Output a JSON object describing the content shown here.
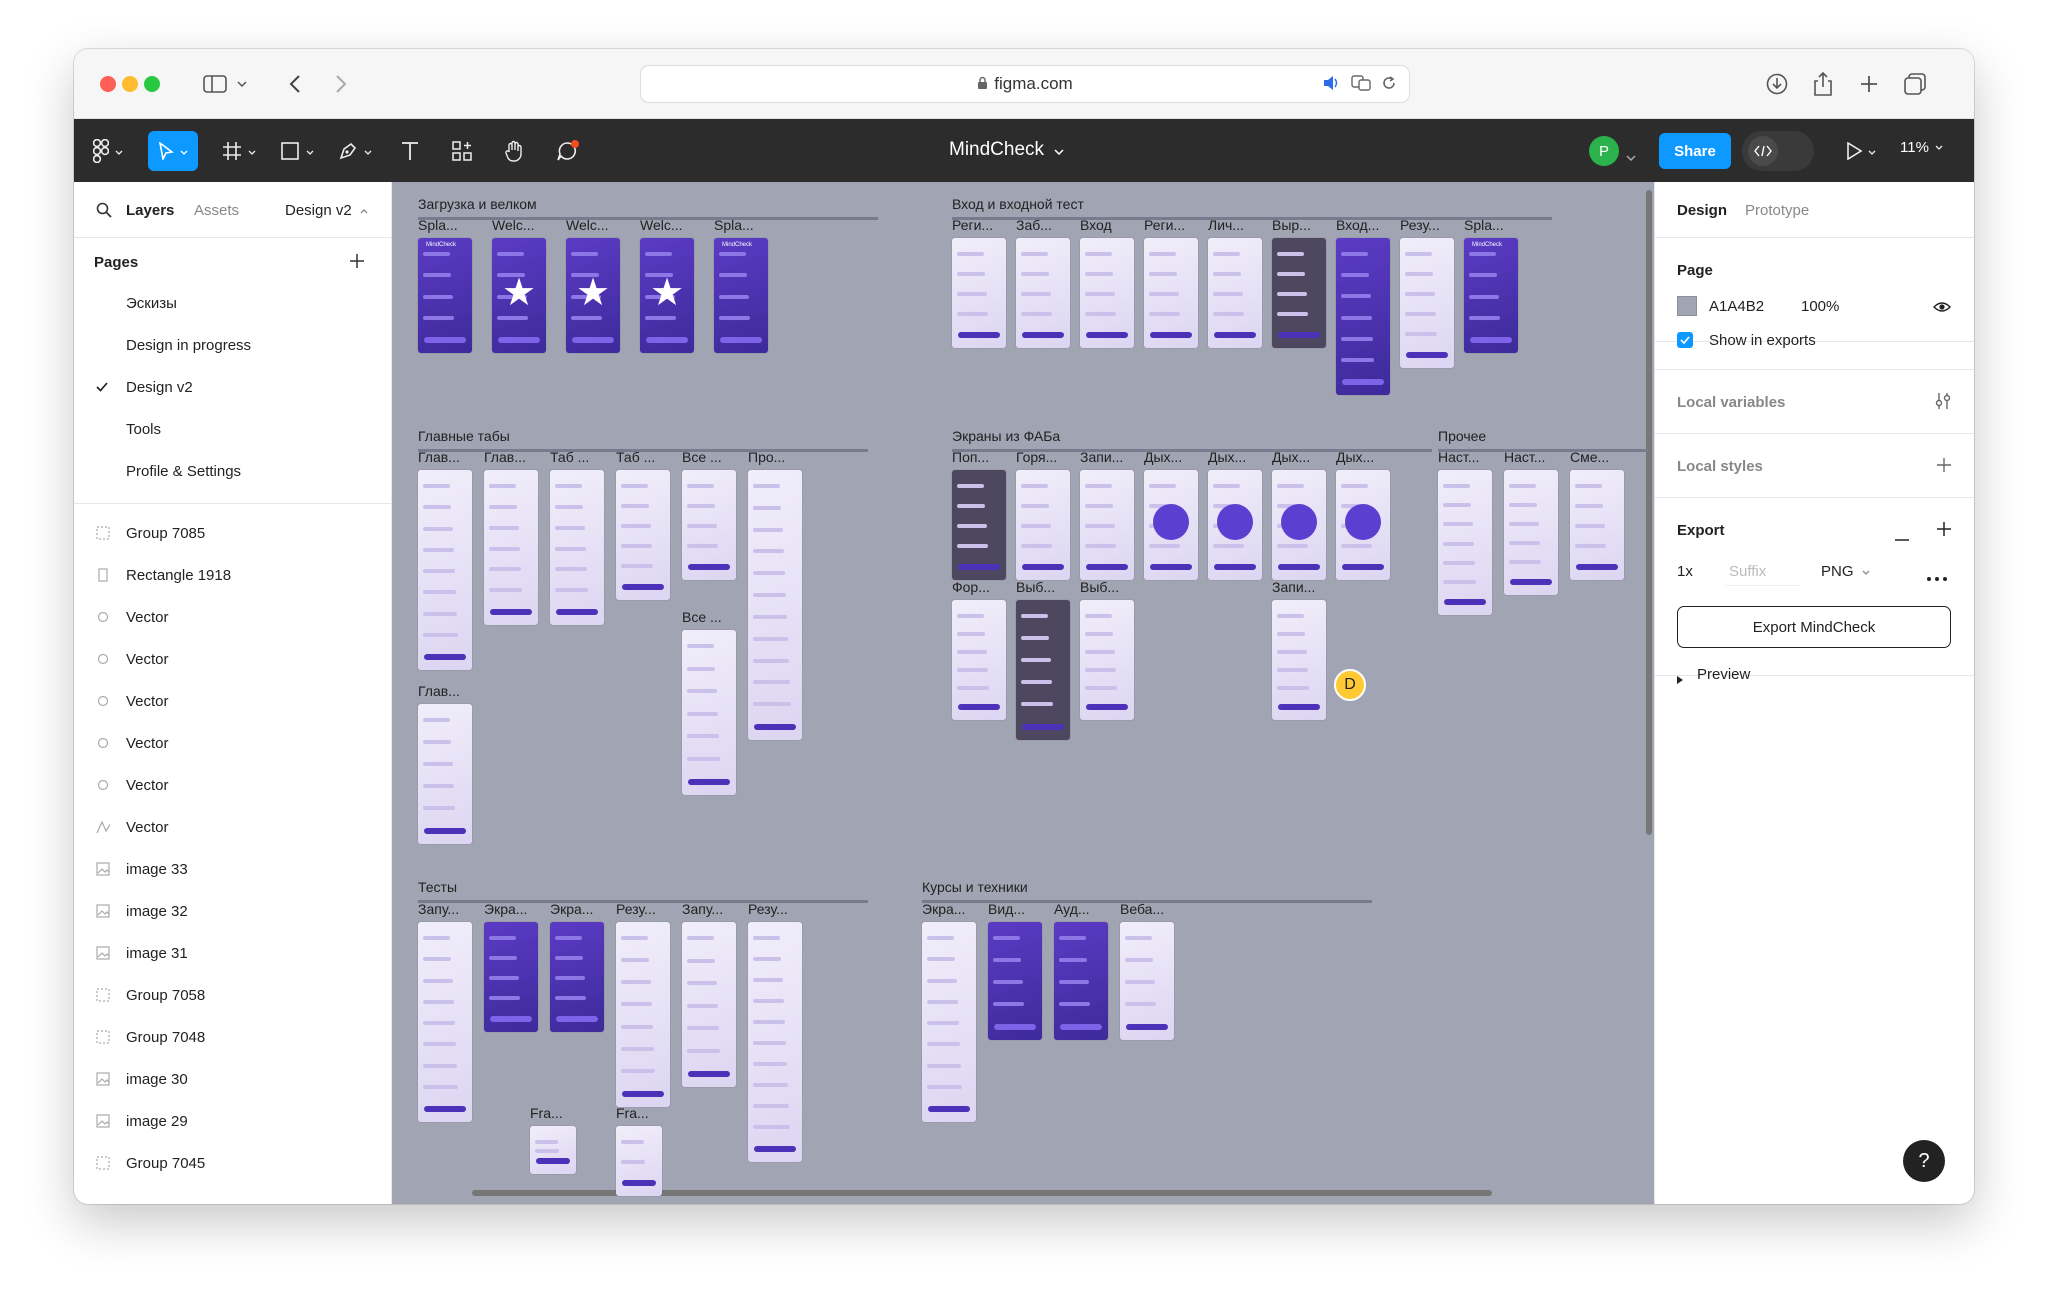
{
  "browser": {
    "url": "figma.com"
  },
  "toolbar": {
    "file_title": "MindCheck",
    "avatar_initial": "P",
    "share_label": "Share",
    "zoom": "11%"
  },
  "left_panel": {
    "tabs": [
      "Layers",
      "Assets"
    ],
    "page_dropdown": "Design v2",
    "pages_heading": "Pages",
    "pages": [
      "Эскизы",
      "Design in progress",
      "Design v2",
      "Tools",
      "Profile & Settings"
    ],
    "layers": [
      {
        "name": "Group 7085",
        "icon": "group-icon"
      },
      {
        "name": "Rectangle 1918",
        "icon": "rectangle-icon"
      },
      {
        "name": "Vector",
        "icon": "ellipse-icon"
      },
      {
        "name": "Vector",
        "icon": "ellipse-icon"
      },
      {
        "name": "Vector",
        "icon": "ellipse-icon"
      },
      {
        "name": "Vector",
        "icon": "ellipse-icon"
      },
      {
        "name": "Vector",
        "icon": "ellipse-icon"
      },
      {
        "name": "Vector",
        "icon": "vector-path-icon"
      },
      {
        "name": "image 33",
        "icon": "image-icon"
      },
      {
        "name": "image 32",
        "icon": "image-icon"
      },
      {
        "name": "image 31",
        "icon": "image-icon"
      },
      {
        "name": "Group 7058",
        "icon": "group-icon"
      },
      {
        "name": "Group 7048",
        "icon": "group-icon"
      },
      {
        "name": "image 30",
        "icon": "image-icon"
      },
      {
        "name": "image 29",
        "icon": "image-icon"
      },
      {
        "name": "Group 7045",
        "icon": "group-icon"
      }
    ]
  },
  "canvas": {
    "background": "#A1A4B2",
    "sections": {
      "s1": "Загрузка и велком",
      "s2": "Вход и входной тест",
      "s3": "Главные табы",
      "s4": "Экраны из ФАБа",
      "s5": "Прочее",
      "s6": "Тесты",
      "s7": "Курсы и техники"
    },
    "frame_labels": {
      "a1": "Spla...",
      "a2": "Welc...",
      "a3": "Welc...",
      "a4": "Welc...",
      "a5": "Spla...",
      "b1": "Реги...",
      "b2": "Заб...",
      "b3": "Вход",
      "b4": "Реги...",
      "b5": "Лич...",
      "b6": "Выр...",
      "b7": "Вход...",
      "b8": "Резу...",
      "b9": "Spla...",
      "c1": "Глав...",
      "c2": "Глав...",
      "c3": "Таб ...",
      "c4": "Таб ...",
      "c5": "Все ...",
      "c6": "Про...",
      "c7": "Все ...",
      "c8": "Глав...",
      "d1": "Поп...",
      "d2": "Горя...",
      "d3": "Запи...",
      "d4": "Дых...",
      "d5": "Дых...",
      "d6": "Дых...",
      "d7": "Дых...",
      "d8": "Фор...",
      "d9": "Выб...",
      "d10": "Выб...",
      "d11": "Запи...",
      "e1": "Наст...",
      "e2": "Наст...",
      "e3": "Сме...",
      "f1": "Запу...",
      "f2": "Экра...",
      "f3": "Экра...",
      "f4": "Резу...",
      "f5": "Запу...",
      "f6": "Резу...",
      "f7": "Fra...",
      "f8": "Fra...",
      "g1": "Экра...",
      "g2": "Вид...",
      "g3": "Ауд...",
      "g4": "Веба..."
    },
    "brand_mark": "MindCheck",
    "collaborator_initial": "D"
  },
  "right_panel": {
    "tabs": [
      "Design",
      "Prototype"
    ],
    "page_heading": "Page",
    "page_color_hex": "A1A4B2",
    "page_opacity": "100%",
    "show_in_exports": "Show in exports",
    "local_variables": "Local variables",
    "local_styles": "Local styles",
    "export_heading": "Export",
    "export_scale": "1x",
    "export_suffix_placeholder": "Suffix",
    "export_format": "PNG",
    "export_button": "Export MindCheck",
    "preview": "Preview"
  },
  "help": "?",
  "colors": {
    "accent": "#0D99FF",
    "toolbar": "#2C2C2C",
    "canvas": "#A1A4B2",
    "brand_purple": "#4B32B8"
  }
}
